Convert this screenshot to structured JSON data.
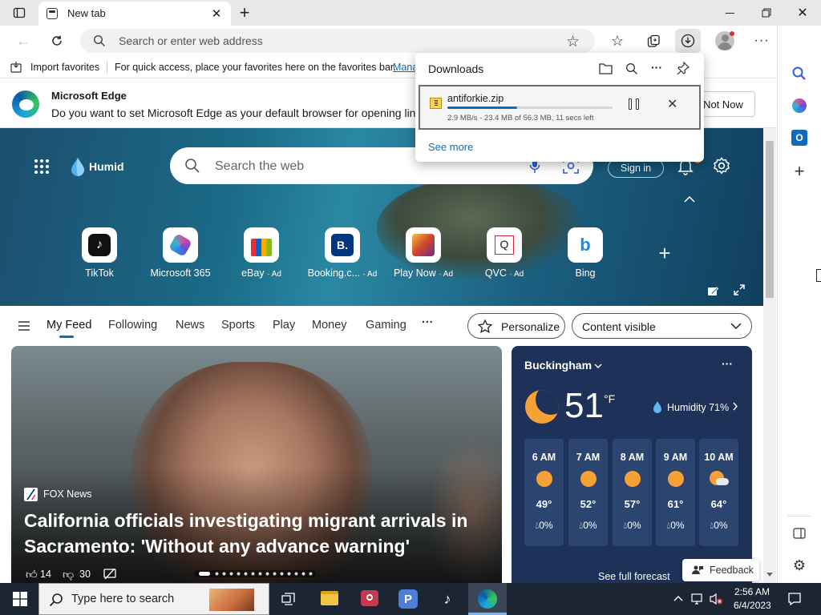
{
  "tab": {
    "title": "New tab"
  },
  "address": {
    "placeholder": "Search or enter web address"
  },
  "favbar": {
    "import": "Import favorites",
    "hint": "For quick access, place your favorites here on the favorites bar.",
    "manage": "Manage favorites now"
  },
  "notice": {
    "title": "Microsoft Edge",
    "text": "Do you want to set Microsoft Edge as your default browser for opening links?",
    "not_now": "Not Now"
  },
  "downloads": {
    "title": "Downloads",
    "file": "antiforkie.zip",
    "status": "2.9 MB/s - 23.4 MB of 56.3 MB, 11 secs left",
    "progress": 0.42,
    "see_more": "See more"
  },
  "hero": {
    "brand": "Humid",
    "search_placeholder": "Search the web",
    "sign_in": "Sign in"
  },
  "tiles": [
    {
      "label": "TikTok",
      "ad": ""
    },
    {
      "label": "Microsoft 365",
      "ad": ""
    },
    {
      "label": "eBay",
      "ad": "· Ad"
    },
    {
      "label": "Booking.c...",
      "ad": "· Ad"
    },
    {
      "label": "Play Now",
      "ad": "· Ad"
    },
    {
      "label": "QVC",
      "ad": "· Ad"
    },
    {
      "label": "Bing",
      "ad": ""
    }
  ],
  "feed": {
    "items": [
      "My Feed",
      "Following",
      "News",
      "Sports",
      "Play",
      "Money",
      "Gaming"
    ],
    "more": "···",
    "personalize": "Personalize",
    "content": "Content visible"
  },
  "news": {
    "source": "FOX News",
    "headline": "California officials investigating migrant arrivals in Sacramento: 'Without any advance warning'",
    "likes": "14",
    "dislikes": "30"
  },
  "weather": {
    "city": "Buckingham",
    "temp": "51",
    "unit": "°F",
    "humidity": "Humidity 71%",
    "see_forecast": "See full forecast",
    "hours": [
      {
        "time": "6 AM",
        "temp": "49°",
        "precip": "0%",
        "icon": "sun"
      },
      {
        "time": "7 AM",
        "temp": "52°",
        "precip": "0%",
        "icon": "sun"
      },
      {
        "time": "8 AM",
        "temp": "57°",
        "precip": "0%",
        "icon": "sun"
      },
      {
        "time": "9 AM",
        "temp": "61°",
        "precip": "0%",
        "icon": "sun"
      },
      {
        "time": "10 AM",
        "temp": "64°",
        "precip": "0%",
        "icon": "partly-cloudy"
      }
    ]
  },
  "feedback": "Feedback",
  "taskbar": {
    "search_placeholder": "Type here to search",
    "time": "2:56 AM",
    "date": "6/4/2023"
  },
  "colors": {
    "accent": "#0f6cbd",
    "progress": "#0f6cbd",
    "hero": "#1a6a87",
    "weather_bg": "#1e3158",
    "taskbar": "#1c2533"
  }
}
